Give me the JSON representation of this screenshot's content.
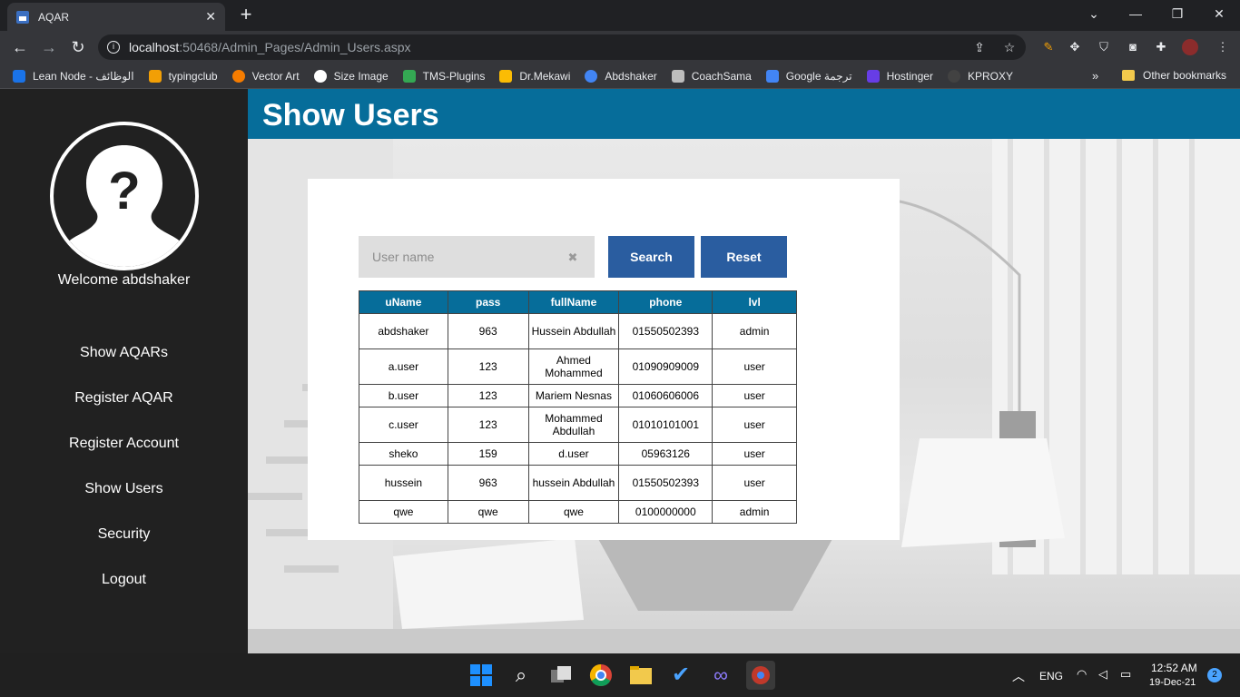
{
  "browser": {
    "tab_title": "AQAR",
    "url_host": "localhost",
    "url_path": ":50468/Admin_Pages/Admin_Users.aspx",
    "bookmarks": [
      {
        "label": "Lean Node - الوظائف",
        "color": "#1a73e8"
      },
      {
        "label": "typingclub",
        "color": "#f29f05"
      },
      {
        "label": "Vector Art",
        "color": "#f57c00"
      },
      {
        "label": "Size Image",
        "color": "#ffffff"
      },
      {
        "label": "TMS-Plugins",
        "color": "#34a853"
      },
      {
        "label": "Dr.Mekawi",
        "color": "#fbbc04"
      },
      {
        "label": "Abdshaker",
        "color": "#4285f4"
      },
      {
        "label": "CoachSama",
        "color": "#bdbdbd"
      },
      {
        "label": "Google ترجمة",
        "color": "#4285f4"
      },
      {
        "label": "Hostinger",
        "color": "#673de6"
      },
      {
        "label": "KPROXY",
        "color": "#424242"
      }
    ],
    "more_label": "»",
    "other_bookmarks": "Other bookmarks"
  },
  "sidebar": {
    "welcome": "Welcome abdshaker",
    "links": [
      "Show AQARs",
      "Register AQAR",
      "Register Account",
      "Show Users",
      "Security",
      "Logout"
    ]
  },
  "header": {
    "title": "Show Users"
  },
  "search": {
    "placeholder": "User name",
    "search_label": "Search",
    "reset_label": "Reset"
  },
  "table": {
    "columns": [
      "uName",
      "pass",
      "fullName",
      "phone",
      "lvl"
    ],
    "rows": [
      [
        "abdshaker",
        "963",
        "Hussein Abdullah",
        "01550502393",
        "admin"
      ],
      [
        "a.user",
        "123",
        "Ahmed Mohammed",
        "01090909009",
        "user"
      ],
      [
        "b.user",
        "123",
        "Mariem Nesnas",
        "01060606006",
        "user"
      ],
      [
        "c.user",
        "123",
        "Mohammed Abdullah",
        "01010101001",
        "user"
      ],
      [
        "sheko",
        "159",
        "d.user",
        "05963126",
        "user"
      ],
      [
        "hussein",
        "963",
        "hussein Abdullah",
        "01550502393",
        "user"
      ],
      [
        "qwe",
        "qwe",
        "qwe",
        "0100000000",
        "admin"
      ]
    ]
  },
  "taskbar": {
    "language": "ENG",
    "time": "12:52 AM",
    "date": "19-Dec-21",
    "notifications": "2"
  },
  "colors": {
    "header": "#066d9a",
    "button": "#2a5da0",
    "sidebar": "#212121"
  }
}
